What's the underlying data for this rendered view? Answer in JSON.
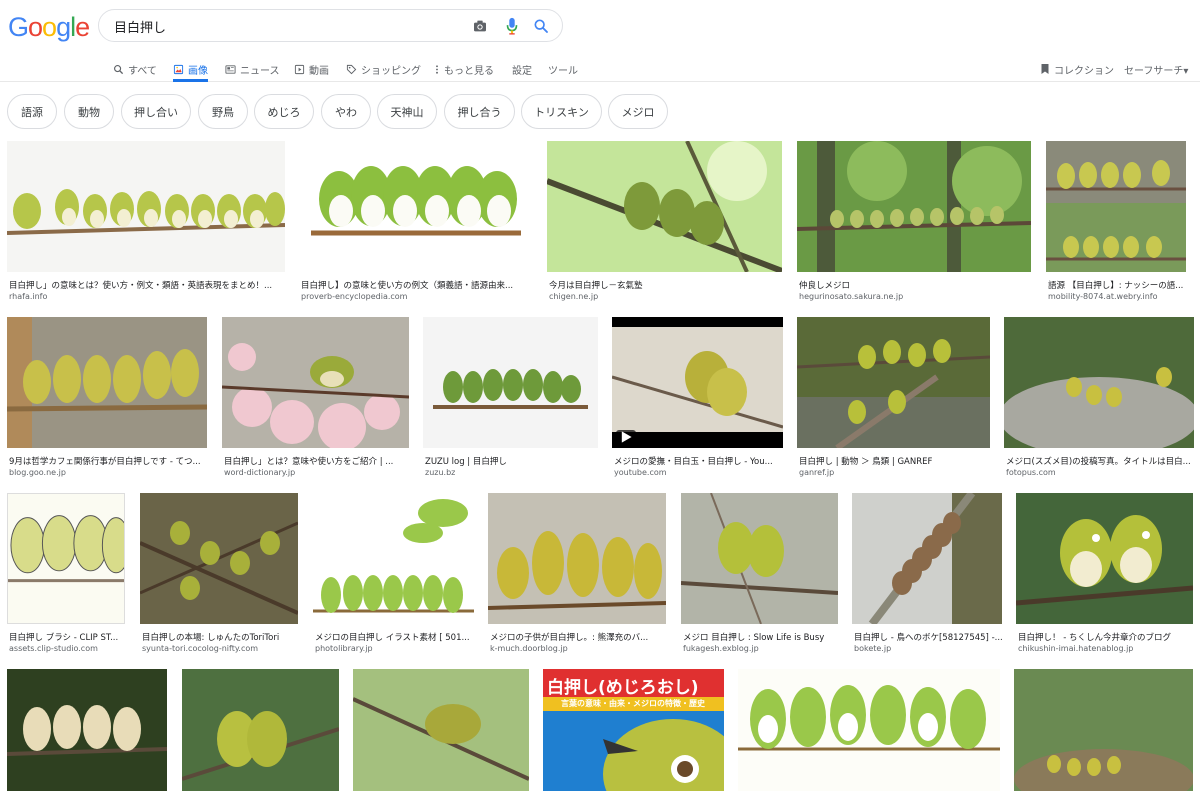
{
  "logo": {
    "letters": [
      "G",
      "o",
      "o",
      "g",
      "l",
      "e"
    ],
    "colors": [
      "#4285f4",
      "#ea4335",
      "#fbbc05",
      "#4285f4",
      "#34a853",
      "#ea4335"
    ]
  },
  "search": {
    "query": "目白押し",
    "icons": [
      "camera-icon",
      "mic-icon",
      "search-icon"
    ]
  },
  "tabs": [
    {
      "label": "すべて",
      "icon": "search-icon"
    },
    {
      "label": "画像",
      "icon": "image-icon",
      "active": true
    },
    {
      "label": "ニュース",
      "icon": "news-icon"
    },
    {
      "label": "動画",
      "icon": "video-icon"
    },
    {
      "label": "ショッピング",
      "icon": "tag-icon"
    },
    {
      "label": "もっと見る",
      "icon": "more-icon"
    },
    {
      "label": "設定"
    },
    {
      "label": "ツール"
    }
  ],
  "right_tools": {
    "collection": "コレクション",
    "safesearch": "セーフサーチ▾"
  },
  "chips": [
    "語源",
    "動物",
    "押し合い",
    "野鳥",
    "めじろ",
    "やわ",
    "天神山",
    "押し合う",
    "トリスキン",
    "メジロ"
  ],
  "results": [
    {
      "caption": "目白押し」の意味とは？使い方・例文・類語・英語表現をまとめ！...",
      "source": "rhafa.info"
    },
    {
      "caption": "目白押し】の意味と使い方の例文（類義語・語源由来...",
      "source": "proverb-encyclopedia.com"
    },
    {
      "caption": "今月は目白押し－玄氣塾",
      "source": "chigen.ne.jp"
    },
    {
      "caption": "仲良しメジロ",
      "source": "hegurinosato.sakura.ne.jp"
    },
    {
      "caption": "語源 【目白押し】: ナッシーの語...",
      "source": "mobility-8074.at.webry.info"
    },
    {
      "caption": "9月は哲学カフェ関係行事が目白押しです - てつ...",
      "source": "blog.goo.ne.jp"
    },
    {
      "caption": "目白押し」とは？意味や使い方をご紹介 | ...",
      "source": "word-dictionary.jp"
    },
    {
      "caption": "ZUZU log | 目白押し",
      "source": "zuzu.bz"
    },
    {
      "caption": "メジロの愛撫・目白玉・目白押し - You...",
      "source": "youtube.com"
    },
    {
      "caption": "目白押し | 動物 ＞ 鳥類 | GANREF",
      "source": "ganref.jp"
    },
    {
      "caption": "メジロ(スズメ目)の投稿写真。タイトルは目白...",
      "source": "fotopus.com"
    },
    {
      "caption": "目白押し ブラシ - CLIP ST...",
      "source": "assets.clip-studio.com"
    },
    {
      "caption": "目白押しの本場: しゅんたのToriTori",
      "source": "syunta-tori.cocolog-nifty.com"
    },
    {
      "caption": "メジロの目白押し イラスト素材 [ 501...",
      "source": "photolibrary.jp"
    },
    {
      "caption": "メジロの子供が目白押し。: 熊澤充のバ...",
      "source": "k-much.doorblog.jp"
    },
    {
      "caption": "メジロ 目白押し : Slow Life is Busy",
      "source": "fukagesh.exblog.jp"
    },
    {
      "caption": "目白押し - 鳥へのボケ[58127545] -...",
      "source": "bokete.jp"
    },
    {
      "caption": "目白押し！ - ちくしん今井章介のブログ",
      "source": "chikushin-imai.hatenablog.jp"
    }
  ],
  "row4_banner": {
    "title": "白押し(めじろおし)",
    "subtitle": "言葉の意味・由来・メジロの特徴・歴史"
  },
  "colors": {
    "accent": "#1a73e8",
    "bird_green": "#8db33a",
    "bird_yellow": "#c8d43a",
    "branch": "#7a5535"
  }
}
